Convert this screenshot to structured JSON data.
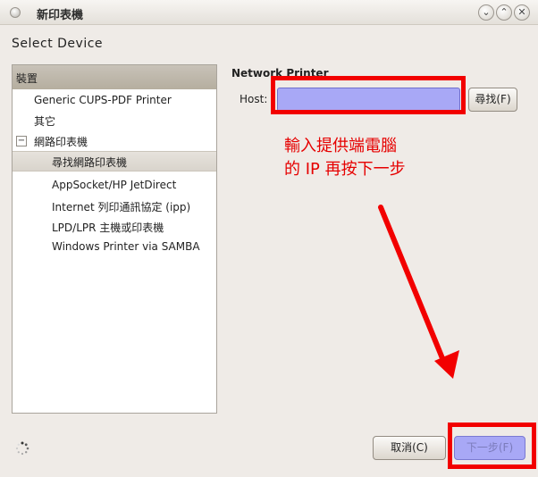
{
  "window": {
    "title": "新印表機",
    "controls": {
      "minimize": "⌄",
      "maximize": "⌃",
      "close": "✕"
    }
  },
  "page": {
    "heading": "Select  Device"
  },
  "device_tree": {
    "header": "裝置",
    "items": [
      {
        "label": "Generic CUPS-PDF Printer"
      },
      {
        "label": "其它"
      },
      {
        "label": "網路印表機",
        "expander": "−"
      },
      {
        "label": "尋找網路印表機",
        "selected": true
      },
      {
        "label": "AppSocket/HP JetDirect"
      },
      {
        "label": "Internet 列印通訊協定 (ipp)"
      },
      {
        "label": "LPD/LPR 主機或印表機"
      },
      {
        "label": "Windows Printer via SAMBA"
      }
    ]
  },
  "network_printer": {
    "title": "Network Printer",
    "host_label": "Host:",
    "host_value": "",
    "find_button": "尋找(F)"
  },
  "annotation": {
    "line1": "輸入提供端電腦",
    "line2": "的 IP 再按下一步",
    "color": "#e60000"
  },
  "footer": {
    "cancel_button": "取消(C)",
    "next_button": "下一步(F)"
  },
  "colors": {
    "highlight_field": "#a8a8f6",
    "annotation_red": "#f20000"
  }
}
